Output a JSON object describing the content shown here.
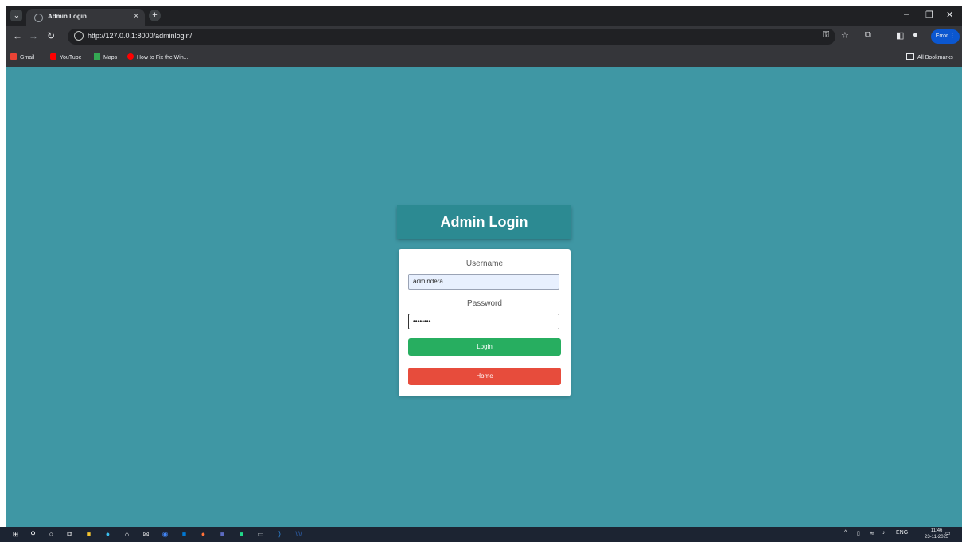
{
  "browser": {
    "tab_title": "Admin Login",
    "url": "http://127.0.0.1:8000/adminlogin/",
    "profile_status": "Error",
    "bookmarks": [
      {
        "label": "Gmail",
        "icon": "gmail-icon",
        "color": "#ea4335"
      },
      {
        "label": "YouTube",
        "icon": "youtube-icon",
        "color": "#ff0000"
      },
      {
        "label": "Maps",
        "icon": "maps-icon",
        "color": "#34a853"
      },
      {
        "label": "How to Fix the Win...",
        "icon": "youtube-icon",
        "color": "#ff0000"
      }
    ],
    "all_bookmarks": "All Bookmarks"
  },
  "page": {
    "background": "#3f97a4",
    "header_title": "Admin Login",
    "username_label": "Username",
    "username_value": "admindera",
    "password_label": "Password",
    "password_mask": "••••••••",
    "login_button": "Login",
    "home_button": "Home",
    "login_color": "#27ae60",
    "home_color": "#e74c3c"
  },
  "taskbar": {
    "language": "ENG",
    "time": "11:46",
    "date": "23-11-2023"
  }
}
